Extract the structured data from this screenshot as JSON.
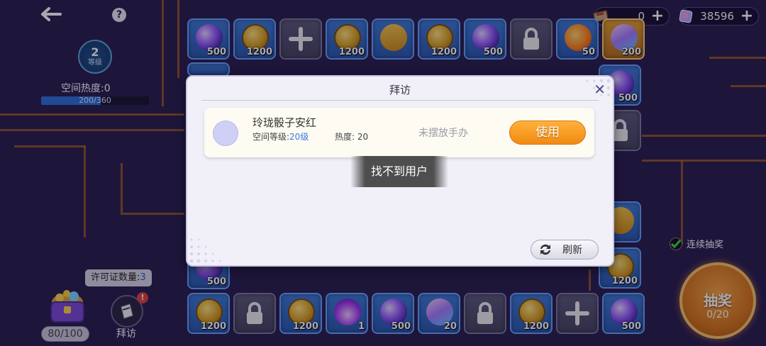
{
  "topbar": {
    "currency_a": "0",
    "currency_b": "38596"
  },
  "level": {
    "number": "2",
    "label": "等级",
    "heat_label": "空间热度:0",
    "progress_text": "200/360",
    "progress_fraction": 0.555
  },
  "board_top": [
    {
      "kind": "orb",
      "amount": "500"
    },
    {
      "kind": "coin",
      "amount": "1200"
    },
    {
      "kind": "plus",
      "amount": ""
    },
    {
      "kind": "coin",
      "amount": "1200"
    },
    {
      "kind": "book",
      "amount": ""
    },
    {
      "kind": "coin",
      "amount": "1200"
    },
    {
      "kind": "orb",
      "amount": "500"
    },
    {
      "kind": "lock",
      "amount": ""
    },
    {
      "kind": "drop",
      "amount": "50"
    },
    {
      "kind": "cube",
      "amount": "200"
    }
  ],
  "board_right": [
    {
      "kind": "orb",
      "amount": "500"
    },
    {
      "kind": "lock",
      "amount": ""
    },
    {
      "kind": "book",
      "amount": ""
    },
    {
      "kind": "coin",
      "amount": "1200"
    }
  ],
  "board_bottom": [
    {
      "kind": "coin",
      "amount": "1200"
    },
    {
      "kind": "lock",
      "amount": ""
    },
    {
      "kind": "coin",
      "amount": "1200"
    },
    {
      "kind": "flame",
      "amount": "1"
    },
    {
      "kind": "orb",
      "amount": "500"
    },
    {
      "kind": "cube",
      "amount": "20"
    },
    {
      "kind": "lock",
      "amount": ""
    },
    {
      "kind": "coin",
      "amount": "1200"
    },
    {
      "kind": "plus",
      "amount": ""
    },
    {
      "kind": "orb",
      "amount": "500"
    }
  ],
  "left_tile_amount": "500",
  "permit": {
    "label": "许可证数量:",
    "count": "3",
    "badge": "!"
  },
  "chest_counter": "80/100",
  "visit_label": "拜访",
  "continuous_draw": {
    "label": "连续抽奖",
    "checked": true
  },
  "draw_button": {
    "label": "抽奖",
    "count": "0/20"
  },
  "dialog": {
    "title": "拜访",
    "entry": {
      "name": "玲珑骰子安红",
      "level_label": "空间等级:",
      "level_value": "20级",
      "heat": "热度: 20",
      "status": "未摆放手办",
      "use_label": "使用"
    },
    "toast": "找不到用户",
    "refresh_label": "刷新"
  },
  "colors": {
    "background": "#2a1e4e",
    "tile_blue": "#3e7bd6",
    "accent_orange": "#f08a12",
    "level_blue": "#3a7be0"
  }
}
